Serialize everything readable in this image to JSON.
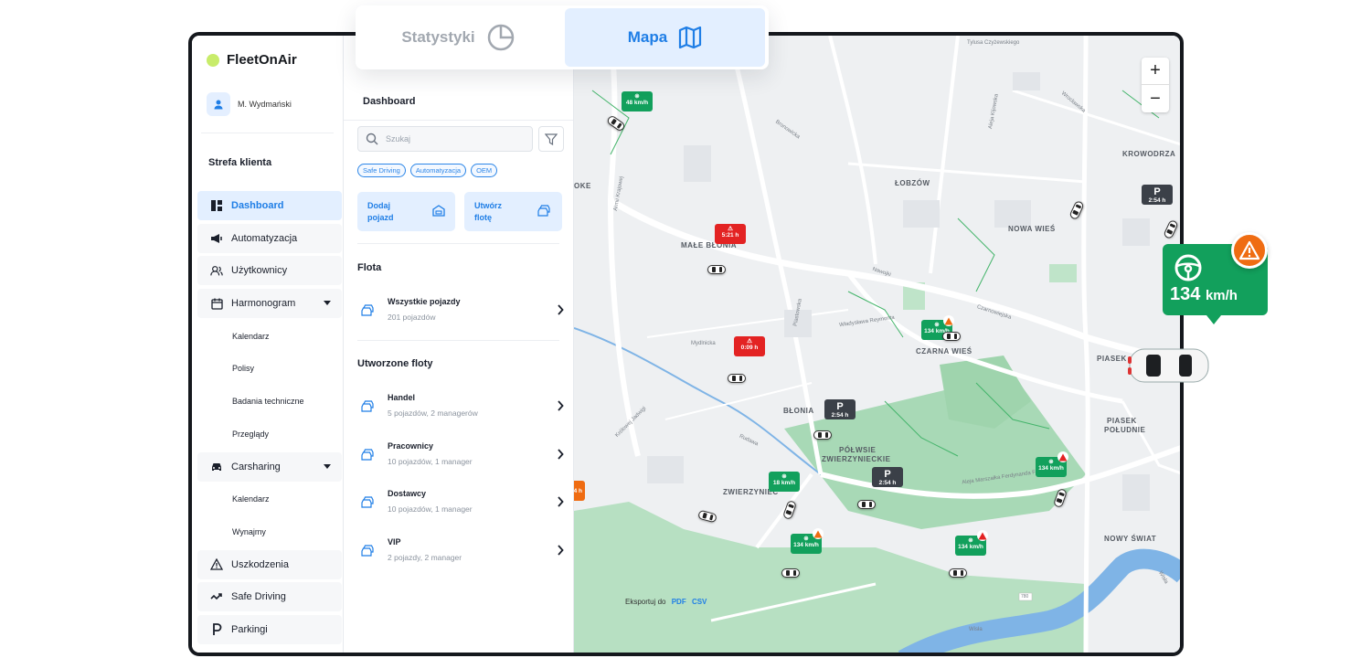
{
  "app": {
    "name": "FleetOnAir",
    "logo_color": "#c8ec6a"
  },
  "user": {
    "name": "M. Wydmański"
  },
  "top_tabs": [
    {
      "label": "Statystyki",
      "icon": "pie-chart-icon",
      "active": false
    },
    {
      "label": "Mapa",
      "icon": "map-icon",
      "active": true
    }
  ],
  "sidebar": {
    "section_title": "Strefa klienta",
    "items": [
      {
        "label": "Dashboard",
        "icon": "dashboard-icon",
        "active": true
      },
      {
        "label": "Automatyzacja",
        "icon": "megaphone-icon"
      },
      {
        "label": "Użytkownicy",
        "icon": "users-icon"
      },
      {
        "label": "Harmonogram",
        "icon": "calendar-icon",
        "expandable": true
      },
      {
        "label": "Kalendarz",
        "sub": true
      },
      {
        "label": "Polisy",
        "sub": true
      },
      {
        "label": "Badania techniczne",
        "sub": true
      },
      {
        "label": "Przeglądy",
        "sub": true
      },
      {
        "label": "Carsharing",
        "icon": "car-icon",
        "expandable": true
      },
      {
        "label": "Kalendarz",
        "sub": true
      },
      {
        "label": "Wynajmy",
        "sub": true
      },
      {
        "label": "Uszkodzenia",
        "icon": "warning-icon"
      },
      {
        "label": "Safe Driving",
        "icon": "trend-icon"
      },
      {
        "label": "Parkingi",
        "icon": "parking-icon"
      }
    ]
  },
  "panel": {
    "title": "Dashboard",
    "search_placeholder": "Szukaj",
    "chips": [
      "Safe Driving",
      "Automatyzacja",
      "OEM"
    ],
    "actions": [
      {
        "line1": "Dodaj",
        "line2": "pojazd"
      },
      {
        "line1": "Utwórz",
        "line2": "flotę"
      }
    ],
    "fleet_title": "Flota",
    "all_vehicles": {
      "name": "Wszystkie pojazdy",
      "sub": "201 pojazdów"
    },
    "created_title": "Utworzone floty",
    "fleets": [
      {
        "name": "Handel",
        "sub": "5 pojazdów, 2 managerów"
      },
      {
        "name": "Pracownicy",
        "sub": "10 pojazdów, 1 manager"
      },
      {
        "name": "Dostawcy",
        "sub": "10 pojazdów, 1 manager"
      },
      {
        "name": "VIP",
        "sub": "2 pojazdy, 2 manager"
      }
    ]
  },
  "map": {
    "zoom_in": "+",
    "zoom_out": "−",
    "districts": [
      "ŁOBZÓW",
      "NOWA WIEŚ",
      "KROWODRZA",
      "MAŁE BŁONIA",
      "CZARNA WIEŚ",
      "BŁONIA",
      "PÓŁWSIE",
      "ZWIERZYNIECKIE",
      "ZWIERZYNIEC",
      "PIASEK",
      "PIASEK",
      "POŁUDNIE",
      "NOWY ŚWIAT",
      "OKE"
    ],
    "streets": [
      "Tylusa Czyżewskiego",
      "Nawojki",
      "Czarnowiejska",
      "Władysława Reymonta",
      "Aleja Marszałka Ferdynanda Focha",
      "Królowej Jadwigi",
      "Rudawa",
      "Wisła",
      "Bronowicka",
      "Armii Krajowej",
      "Wrocławska",
      "Aleja Kijowska",
      "Piastowska",
      "Mydlnicka",
      "Wisła"
    ],
    "pins": [
      {
        "type": "green",
        "text": "48 km/h"
      },
      {
        "type": "red",
        "text": "5:21 h"
      },
      {
        "type": "red",
        "text": "0:09 h"
      },
      {
        "type": "dark",
        "letter": "P",
        "text": "2:54 h"
      },
      {
        "type": "dark",
        "letter": "P",
        "text": "2:54 h"
      },
      {
        "type": "dark",
        "letter": "P",
        "text": "2:54 h"
      },
      {
        "type": "green",
        "text": "134 km/h"
      },
      {
        "type": "green",
        "text": "18 km/h"
      },
      {
        "type": "green",
        "text": "134 km/h"
      },
      {
        "type": "green",
        "text": "134 km/h"
      },
      {
        "type": "green",
        "text": "134 km/h"
      },
      {
        "type": "orange",
        "text": "4 h"
      }
    ],
    "export_label": "Eksportuj do",
    "export_pdf": "PDF",
    "export_csv": "CSV",
    "road_badge": "780"
  },
  "callout": {
    "value": "134",
    "unit": "km/h",
    "color": "#12a05c",
    "warning_color": "#ef6c12"
  }
}
